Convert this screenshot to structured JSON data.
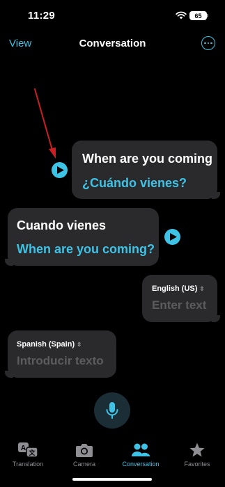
{
  "status_bar": {
    "time": "11:29",
    "battery": "65"
  },
  "nav": {
    "view_label": "View",
    "title": "Conversation"
  },
  "messages": [
    {
      "original": "When are you coming",
      "translation": "¿Cuándo vienes?"
    },
    {
      "original": "Cuando vienes",
      "translation": "When are you coming?"
    }
  ],
  "inputs": {
    "english": {
      "language": "English (US)",
      "placeholder": "Enter text"
    },
    "spanish": {
      "language": "Spanish (Spain)",
      "placeholder": "Introducir texto"
    }
  },
  "tabs": [
    {
      "label": "Translation",
      "icon": "translation-icon"
    },
    {
      "label": "Camera",
      "icon": "camera-icon"
    },
    {
      "label": "Conversation",
      "icon": "people-icon",
      "active": true
    },
    {
      "label": "Favorites",
      "icon": "star-icon"
    }
  ],
  "colors": {
    "accent": "#3ec3e6",
    "bubble": "#2a2a2c",
    "annotation_arrow": "#cc1f24"
  }
}
